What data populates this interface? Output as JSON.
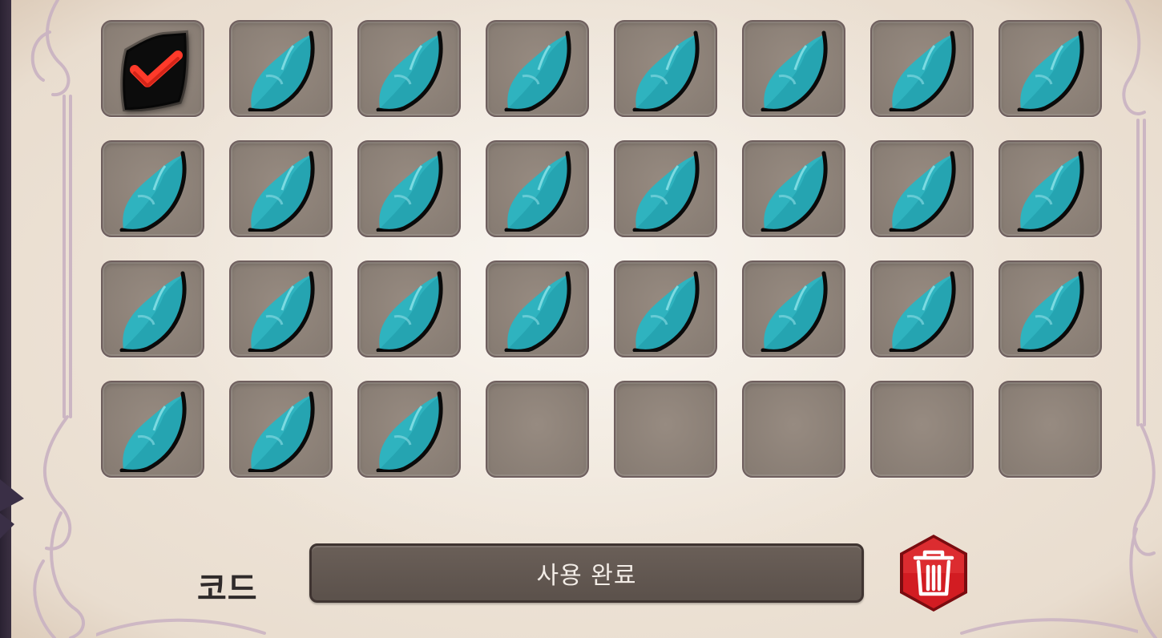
{
  "inventory": {
    "slots": [
      {
        "item": "code-card-used",
        "selected": true
      },
      {
        "item": "teal-feather"
      },
      {
        "item": "teal-feather"
      },
      {
        "item": "teal-feather"
      },
      {
        "item": "teal-feather"
      },
      {
        "item": "teal-feather"
      },
      {
        "item": "teal-feather"
      },
      {
        "item": "teal-feather"
      },
      {
        "item": "teal-feather"
      },
      {
        "item": "teal-feather"
      },
      {
        "item": "teal-feather"
      },
      {
        "item": "teal-feather"
      },
      {
        "item": "teal-feather"
      },
      {
        "item": "teal-feather"
      },
      {
        "item": "teal-feather"
      },
      {
        "item": "teal-feather"
      },
      {
        "item": "teal-feather"
      },
      {
        "item": "teal-feather"
      },
      {
        "item": "teal-feather"
      },
      {
        "item": "teal-feather"
      },
      {
        "item": "teal-feather"
      },
      {
        "item": "teal-feather"
      },
      {
        "item": "teal-feather"
      },
      {
        "item": "teal-feather"
      },
      {
        "item": "teal-feather"
      },
      {
        "item": "teal-feather"
      },
      {
        "item": "teal-feather"
      },
      {
        "item": null
      },
      {
        "item": null
      },
      {
        "item": null
      },
      {
        "item": null
      },
      {
        "item": null
      }
    ]
  },
  "code": {
    "label": "코드",
    "value": "사용 완료"
  },
  "delete_button": {
    "icon": "trash-icon"
  },
  "colors": {
    "parchment": "#efe6da",
    "slot_fill": "#8f847b",
    "feather_teal": "#2fb3bf",
    "check_red": "#e0241c",
    "delete_red": "#c4161c",
    "field_fill": "#5f5550"
  }
}
